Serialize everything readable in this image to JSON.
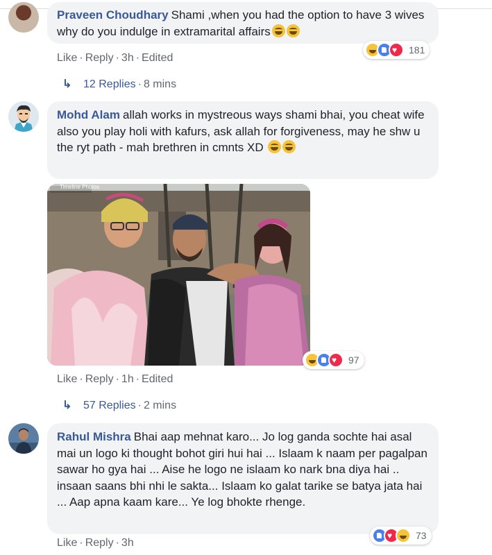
{
  "comments": [
    {
      "author": "Praveen Choudhary",
      "text": "Shami ,when you had the option to have 3 wives why do you indulge in extramarital affairs",
      "emoji": "😂😂",
      "actions": {
        "like": "Like",
        "reply": "Reply",
        "time": "3h",
        "edited": "Edited"
      },
      "reactions": {
        "icons": [
          "haha",
          "like",
          "love"
        ],
        "count": "181"
      },
      "replies": {
        "count": "12 Replies",
        "time": "8 mins"
      }
    },
    {
      "author": "Mohd Alam",
      "text": "allah works in mystreous ways shami bhai, you cheat wife also you play holi with kafurs, ask allah for forgiveness, may he shw u the ryt path - mah brethren in cmnts XD",
      "emoji": "😂😂",
      "photo": {
        "caption": "Timeline Photos"
      },
      "actions": {
        "like": "Like",
        "reply": "Reply",
        "time": "1h",
        "edited": "Edited"
      },
      "reactions": {
        "icons": [
          "haha",
          "like",
          "love"
        ],
        "count": "97"
      },
      "replies": {
        "count": "57 Replies",
        "time": "2 mins"
      }
    },
    {
      "author": "Rahul Mishra",
      "text": "Bhai aap mehnat karo... Jo log ganda sochte hai asal mai un logo ki thought bohot giri hui hai ... Islaam k naam per pagalpan sawar ho gya hai ... Aise he logo ne islaam ko nark bna diya hai .. insaan saans bhi nhi le sakta... Islaam ko galat tarike se batya jata hai ... Aap apna kaam kare... Ye log bhokte rhenge.",
      "actions": {
        "like": "Like",
        "reply": "Reply",
        "time": "3h"
      },
      "reactions": {
        "icons": [
          "like",
          "love",
          "haha"
        ],
        "count": "73"
      }
    }
  ],
  "colors": {
    "author": "#385898",
    "bubble": "#f2f3f5",
    "meta": "#606770"
  }
}
